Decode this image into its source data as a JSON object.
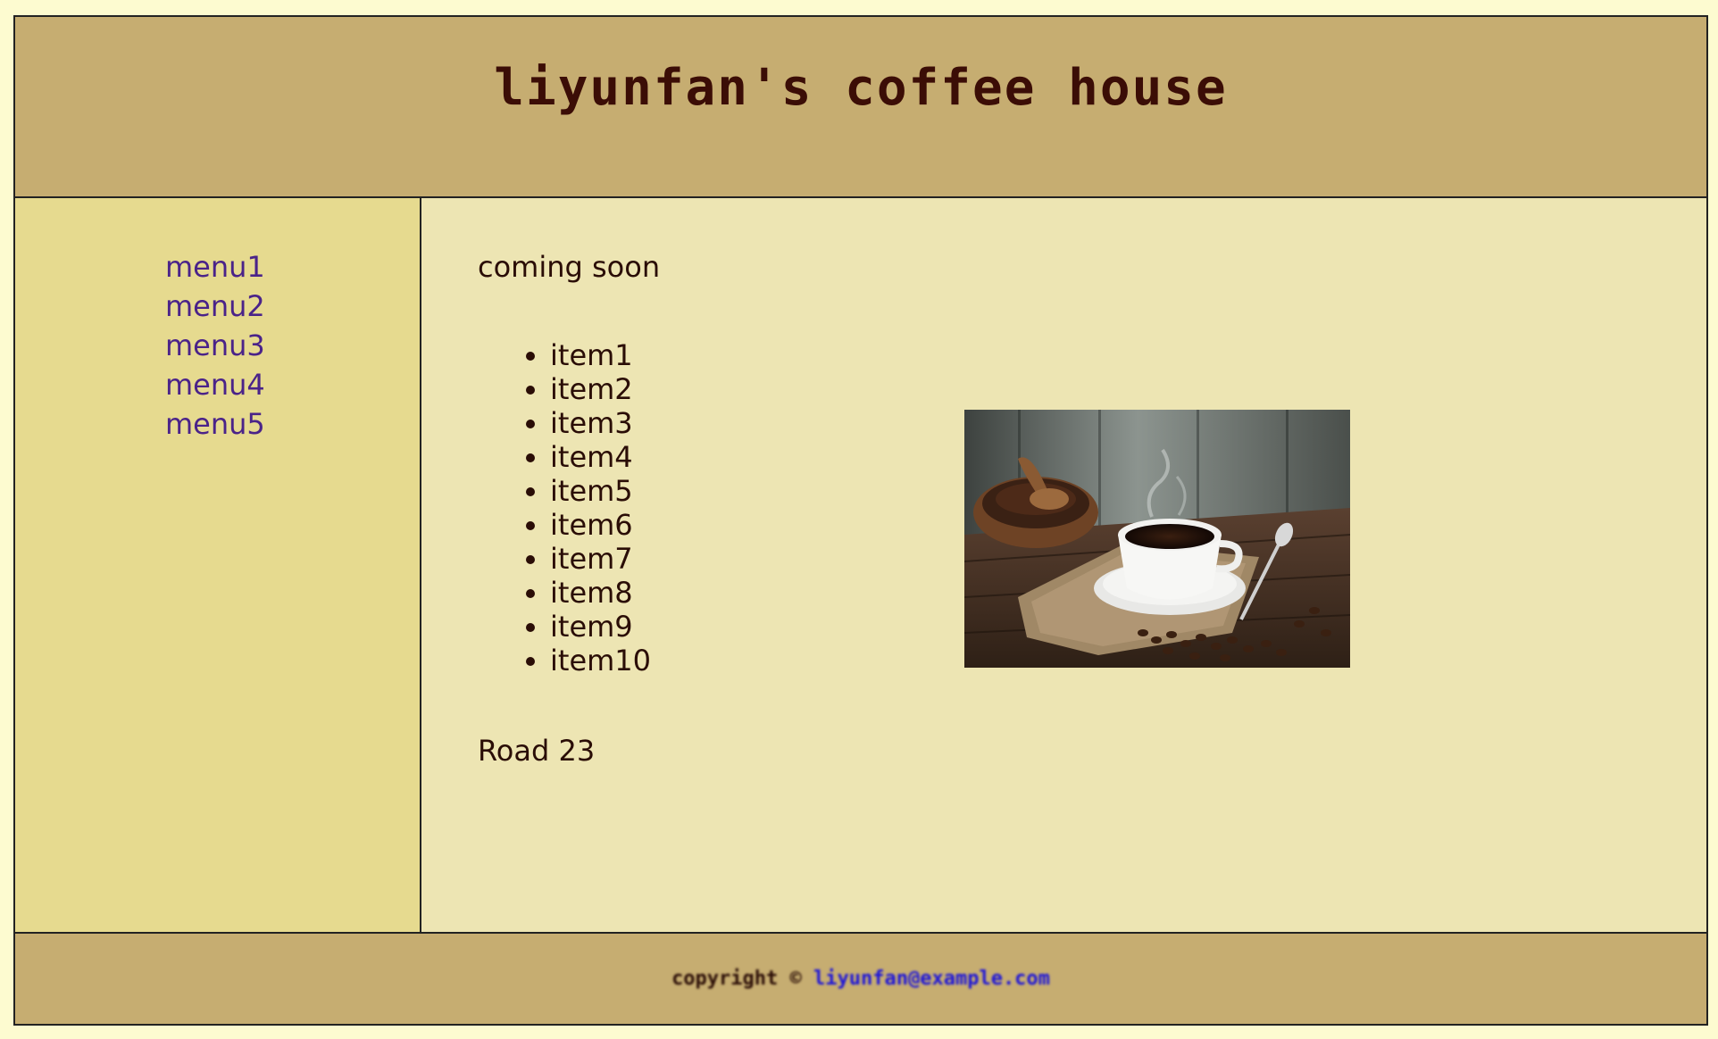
{
  "header": {
    "title": "liyunfan's coffee house"
  },
  "sidebar": {
    "menu": [
      {
        "label": "menu1"
      },
      {
        "label": "menu2"
      },
      {
        "label": "menu3"
      },
      {
        "label": "menu4"
      },
      {
        "label": "menu5"
      }
    ]
  },
  "main": {
    "intro": "coming soon",
    "items": [
      "item1",
      "item2",
      "item3",
      "item4",
      "item5",
      "item6",
      "item7",
      "item8",
      "item9",
      "item10"
    ],
    "address": "Road 23",
    "image": {
      "subject": "coffee-cup-photo"
    }
  },
  "footer": {
    "copyright": "copyright ©",
    "link_text": "liyunfan@example.com"
  },
  "colors": {
    "header_bg": "#c6ad71",
    "sidebar_bg": "#e6da8f",
    "content_bg": "#ede5b3",
    "page_bg": "#fdfbd0",
    "link": "#4a2389",
    "title": "#3b0d06"
  }
}
